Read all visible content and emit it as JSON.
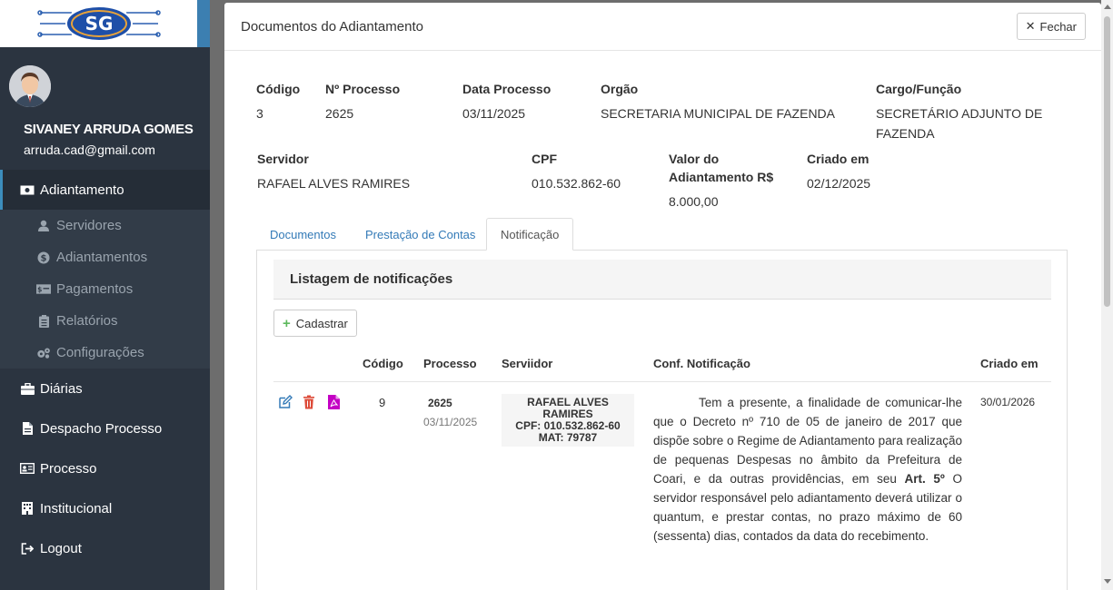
{
  "sidebar": {
    "user_name": "SIVANEY ARRUDA GOMES",
    "user_email": "arruda.cad@gmail.com",
    "items": [
      {
        "label": "Adiantamento",
        "icon": "money-icon"
      },
      {
        "label": "Servidores",
        "icon": "user-icon"
      },
      {
        "label": "Adiantamentos",
        "icon": "coin-icon"
      },
      {
        "label": "Pagamentos",
        "icon": "cash-icon"
      },
      {
        "label": "Relatórios",
        "icon": "clipboard-icon"
      },
      {
        "label": "Configurações",
        "icon": "gears-icon"
      },
      {
        "label": "Diárias",
        "icon": "briefcase-icon"
      },
      {
        "label": "Despacho Processo",
        "icon": "file-icon"
      },
      {
        "label": "Processo",
        "icon": "id-card-icon"
      },
      {
        "label": "Institucional",
        "icon": "building-icon"
      },
      {
        "label": "Logout",
        "icon": "logout-icon"
      }
    ]
  },
  "modal": {
    "title": "Documentos do Adiantamento",
    "close_label": "Fechar",
    "info": {
      "codigo_label": "Código",
      "codigo": "3",
      "processo_label": "Nº Processo",
      "processo": "2625",
      "data_label": "Data Processo",
      "data": "03/11/2025",
      "orgao_label": "Orgão",
      "orgao": "SECRETARIA MUNICIPAL DE FAZENDA",
      "cargo_label": "Cargo/Função",
      "cargo_1": "SECRETÁRIO ADJUNTO DE",
      "cargo_2": "FAZENDA",
      "servidor_label": "Servidor",
      "servidor": "RAFAEL ALVES RAMIRES",
      "cpf_label": "CPF",
      "cpf": "010.532.862-60",
      "valor_label_1": "Valor do",
      "valor_label_2": "Adiantamento R$",
      "valor": "8.000,00",
      "criado_label": "Criado em",
      "criado": "02/12/2025"
    },
    "tabs": [
      {
        "label": "Documentos"
      },
      {
        "label": "Prestação de Contas"
      },
      {
        "label": "Notificação"
      }
    ],
    "list_title": "Listagem de notificações",
    "add_label": "Cadastrar",
    "table": {
      "headers": [
        "Código",
        "Processo",
        "Serviidor",
        "Conf. Notificação",
        "Criado em"
      ],
      "row": {
        "codigo": "9",
        "processo": "2625",
        "processo_data": "03/11/2025",
        "servidor_nome": "RAFAEL ALVES RAMIRES",
        "servidor_cpf": "CPF: 010.532.862-60",
        "servidor_mat": "MAT: 79787",
        "notif_part1": "Tem a presente, a finalidade de comunicar-lhe que o Decreto nº 710 de 05 de janeiro de 2017 que dispõe sobre o Regime de Adiantamento para realização de pequenas Despesas no âmbito da Prefeitura de Coari, e da outras providências, em seu",
        "notif_bold": "Art. 5º",
        "notif_part2": "O servidor responsável pelo adiantamento deverá utilizar o quantum, e prestar contas, no prazo máximo de 60 (sessenta) dias, contados da data do recebimento.",
        "criado": "30/01/2026"
      }
    }
  },
  "colors": {
    "sidebar_bg": "#2b3440",
    "accent": "#3c8dbc",
    "link": "#337ab7",
    "edit_icon": "#337ab7",
    "delete_icon": "#dd4b39",
    "pdf_icon": "#c400c4"
  }
}
